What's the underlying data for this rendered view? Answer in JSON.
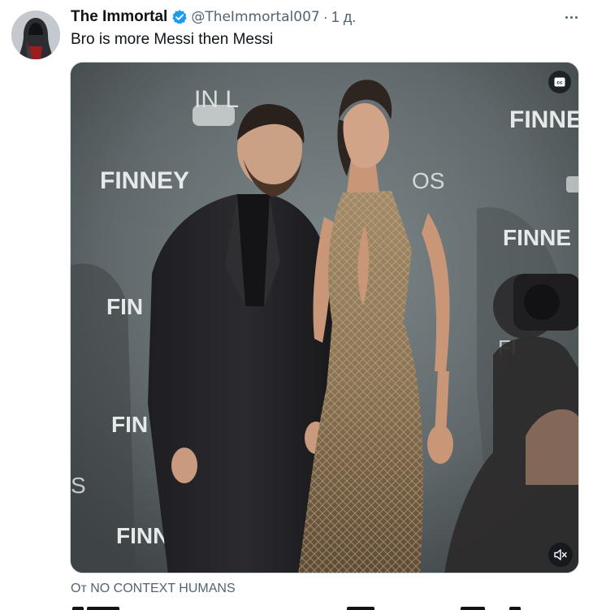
{
  "tweet": {
    "display_name": "The Immortal",
    "handle": "@TheImmortal007",
    "separator": "·",
    "time": "1 д.",
    "text": "Bro is more Messi then Messi"
  },
  "media": {
    "type": "video",
    "backdrop_brand": "FINNEY",
    "backdrop_partial_1": "FINNE",
    "backdrop_partial_2": "FIN",
    "backdrop_partial_3": "FI",
    "backdrop_partial_4": "S",
    "backdrop_partial_5": "IN L",
    "backdrop_partial_6": "OS",
    "captions_icon": "cc-icon",
    "mute_icon": "speaker-muted-icon"
  },
  "attribution": {
    "prefix": "От",
    "source": "NO CONTEXT HUMANS"
  },
  "colors": {
    "text_primary": "#0f1419",
    "text_secondary": "#536471",
    "verified_blue": "#1d9bf0",
    "border": "#cfd9de"
  }
}
